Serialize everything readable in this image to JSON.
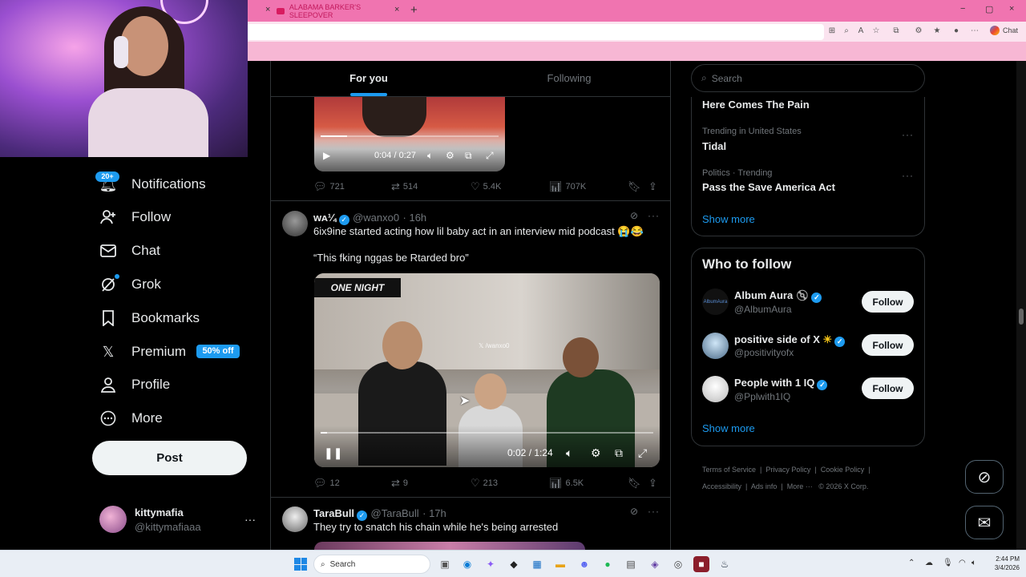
{
  "browser": {
    "tab_title": "ALABAMA BARKER'S SLEEPOVER",
    "tab_close": "×",
    "new_tab": "+",
    "win_min": "−",
    "win_max": "▢",
    "win_close": "×",
    "chat_label": "Chat"
  },
  "nav": {
    "notifications": "Notifications",
    "notif_badge": "20+",
    "follow": "Follow",
    "chat": "Chat",
    "grok": "Grok",
    "bookmarks": "Bookmarks",
    "premium": "Premium",
    "premium_badge": "50% off",
    "profile": "Profile",
    "more": "More",
    "post": "Post"
  },
  "account": {
    "name": "kittymafia",
    "handle": "@kittymafiaaa",
    "more": "···"
  },
  "feed": {
    "tab_foryou": "For you",
    "tab_following": "Following"
  },
  "video1": {
    "time": "0:04 / 0:27",
    "progress": 0.15
  },
  "post1_stats": {
    "replies": "721",
    "reposts": "514",
    "likes": "5.4K",
    "views": "707K"
  },
  "post2": {
    "name": "ᴡᴀ¼",
    "handle": "@wanxo0",
    "time": "· 16h",
    "text": "6ix9ine started acting how lil baby act in an interview mid podcast 😭😂",
    "quote": "“This fking nggas be Rtarded bro”",
    "video_logo": "ONE NIGHT",
    "video_watermark": "𝕏 /wanxo0",
    "video_time": "0:02 / 1:24",
    "video_progress": 0.02,
    "replies": "12",
    "reposts": "9",
    "likes": "213",
    "views": "6.5K"
  },
  "post3": {
    "name": "TaraBull",
    "handle": "@TaraBull",
    "time": "· 17h",
    "text": "They try to snatch his chain while he's being arrested"
  },
  "right": {
    "search_placeholder": "Search",
    "trend0_title": "Here Comes The Pain",
    "trend1_meta": "Trending in United States",
    "trend1_title": "Tidal",
    "trend2_meta": "Politics · Trending",
    "trend2_title": "Pass the Save America Act",
    "trends_show_more": "Show more",
    "wtf_title": "Who to follow",
    "wtf": [
      {
        "name": "Album Aura",
        "handle": "@AlbumAura",
        "button": "Follow",
        "avatar_text": "AlbumAura"
      },
      {
        "name": "positive side of X",
        "handle": "@positivityofx",
        "button": "Follow"
      },
      {
        "name": "People with 1 IQ",
        "handle": "@Pplwith1IQ",
        "button": "Follow"
      }
    ],
    "wtf_show_more": "Show more",
    "footer": {
      "terms": "Terms of Service",
      "privacy": "Privacy Policy",
      "cookie": "Cookie Policy",
      "accessibility": "Accessibility",
      "ads": "Ads info",
      "more": "More ···",
      "copyright": "© 2026 X Corp."
    }
  },
  "taskbar": {
    "search": "Search",
    "time": "2:44 PM",
    "date": "3/4/2026",
    "accent": "#1e88e5"
  }
}
